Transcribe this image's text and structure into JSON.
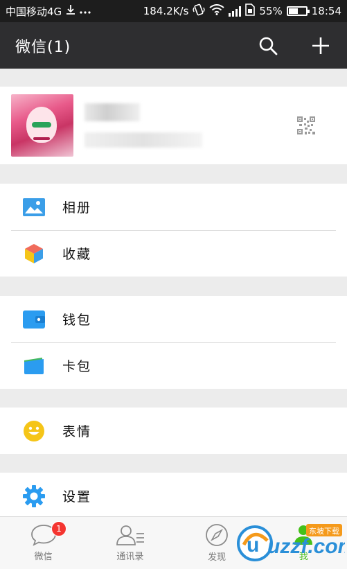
{
  "status_bar": {
    "carrier": "中国移动4G",
    "net_speed": "184.2K/s",
    "battery": "55%",
    "battery_level": 0.55,
    "time": "18:54",
    "icons": [
      "download-icon",
      "more-dots-icon",
      "vibrate-icon",
      "wifi-icon",
      "signal-icon",
      "sim-icon",
      "battery-icon"
    ]
  },
  "header": {
    "title": "微信(1)",
    "actions": [
      "search-icon",
      "plus-icon"
    ]
  },
  "profile": {
    "avatar": "anime-avatar",
    "qr_icon": "qr-code-icon"
  },
  "menu": {
    "group1": [
      {
        "label": "相册",
        "icon": "album-icon",
        "color": "#3b9ee8"
      },
      {
        "label": "收藏",
        "icon": "favorites-cube-icon",
        "color": "#f5a623"
      }
    ],
    "group2": [
      {
        "label": "钱包",
        "icon": "wallet-icon",
        "color": "#2b9cf0"
      },
      {
        "label": "卡包",
        "icon": "card-pack-icon",
        "color": "#2b9cf0"
      }
    ],
    "group3": [
      {
        "label": "表情",
        "icon": "smiley-icon",
        "color": "#f5c518"
      }
    ],
    "group4": [
      {
        "label": "设置",
        "icon": "settings-gear-icon",
        "color": "#2b9cf0"
      }
    ]
  },
  "tabbar": {
    "tabs": [
      {
        "label": "微信",
        "icon": "chat-bubble-icon",
        "badge": "1"
      },
      {
        "label": "通讯录",
        "icon": "contacts-icon"
      },
      {
        "label": "发现",
        "icon": "compass-icon"
      },
      {
        "label": "我",
        "icon": "me-icon"
      }
    ]
  },
  "watermark": {
    "brand": "uzzf.com",
    "tag": "东坡下载"
  },
  "colors": {
    "header_bg": "#2e2e30",
    "accent_green": "#45c01a",
    "badge_red": "#f43530"
  }
}
